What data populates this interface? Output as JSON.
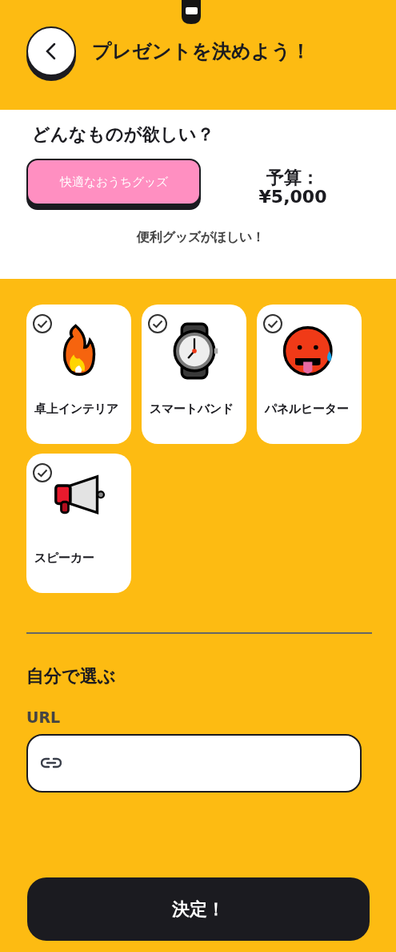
{
  "header": {
    "title": "プレゼントを決めよう！"
  },
  "wish": {
    "question": "どんなものが欲しい？",
    "category_button": "快適なおうちグッズ",
    "budget_label": "予算：",
    "budget_value": "¥5,000",
    "comment": "便利グッズがほしい！"
  },
  "items": [
    {
      "label": "卓上インテリア",
      "checked": true
    },
    {
      "label": "スマートバンド",
      "checked": true
    },
    {
      "label": "パネルヒーター",
      "checked": true
    },
    {
      "label": "スピーカー",
      "checked": true
    }
  ],
  "custom": {
    "heading": "自分で選ぶ",
    "url_label": "URL"
  },
  "submit_button": "決定！"
}
